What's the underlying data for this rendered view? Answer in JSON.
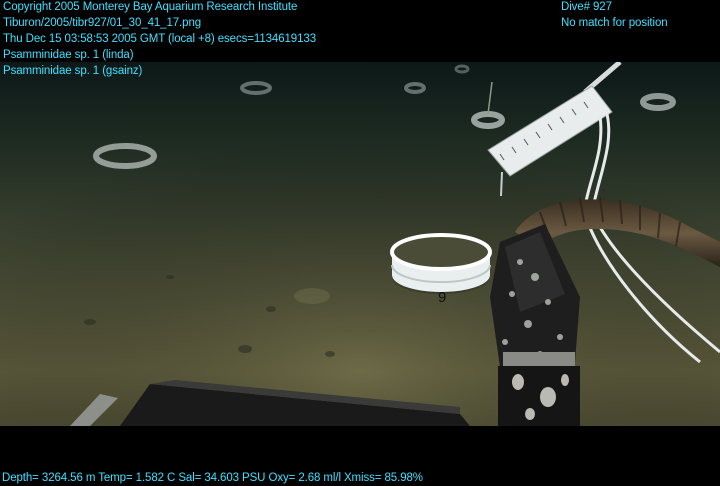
{
  "overlay": {
    "copyright": "Copyright 2005 Monterey Bay Aquarium Research Institute",
    "file_path": "Tiburon/2005/tibr927/01_30_41_17.png",
    "timestamp": "Thu Dec 15 03:58:53 2005 GMT (local +8)  esecs=1134619133",
    "annotation_1": "Psamminidae sp. 1 (linda)",
    "annotation_2": "Psamminidae sp. 1 (gsainz)",
    "dive": "Dive# 927",
    "position_status": "No match for position",
    "telemetry": "Depth= 3264.56 m  Temp= 1.582 C  Sal= 34.603 PSU  Oxy= 2.68 ml/l  Xmiss= 85.98%"
  },
  "scene": {
    "marker_label": "9",
    "colors": {
      "overlay_text": "#3fe0ff",
      "sediment_light": "#6b6a45",
      "sediment_dark": "#1f2a22",
      "water": "#0f1c1c"
    },
    "icons": [
      "survey-ring-marker",
      "ruler-scale-bar",
      "manipulator-arm",
      "suction-hose"
    ]
  }
}
